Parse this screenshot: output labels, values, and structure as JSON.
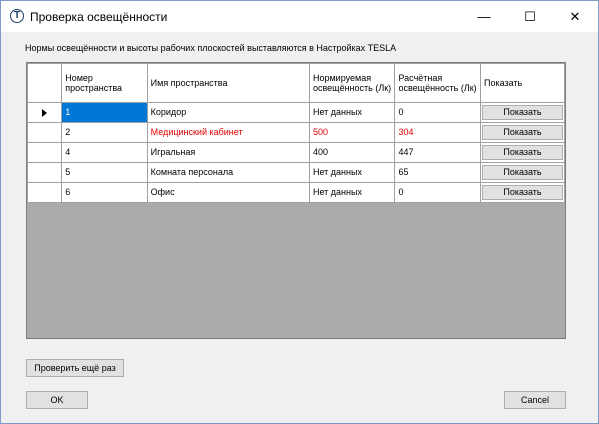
{
  "window": {
    "title": "Проверка освещённости",
    "icon_glyph": "T",
    "controls": {
      "minimize": "—",
      "maximize": "☐",
      "close": "✕"
    }
  },
  "message": "Нормы освещённости и высоты рабочих плоскостей выставляются в Настройках TESLA",
  "table": {
    "headers": {
      "number": "Номер пространства",
      "name": "Имя пространства",
      "norm": "Нормируемая освещённость (Лк)",
      "calc": "Расчётная освещённость (Лк)",
      "show": "Показать"
    },
    "rows": [
      {
        "number": "1",
        "name": "Коридор",
        "norm": "Нет данных",
        "calc": "0",
        "show": "Показать",
        "highlight": false,
        "selected": true
      },
      {
        "number": "2",
        "name": "Медицинский кабинет",
        "norm": "500",
        "calc": "304",
        "show": "Показать",
        "highlight": true,
        "selected": false
      },
      {
        "number": "4",
        "name": "Игральная",
        "norm": "400",
        "calc": "447",
        "show": "Показать",
        "highlight": false,
        "selected": false
      },
      {
        "number": "5",
        "name": "Комната персонала",
        "norm": "Нет данных",
        "calc": "65",
        "show": "Показать",
        "highlight": false,
        "selected": false
      },
      {
        "number": "6",
        "name": "Офис",
        "norm": "Нет данных",
        "calc": "0",
        "show": "Показать",
        "highlight": false,
        "selected": false
      }
    ]
  },
  "buttons": {
    "recheck": "Проверить ещё раз",
    "ok": "OK",
    "cancel": "Cancel"
  },
  "colors": {
    "highlight_text": "#e00000",
    "selection": "#0078d7",
    "grid_background": "#ababab"
  }
}
